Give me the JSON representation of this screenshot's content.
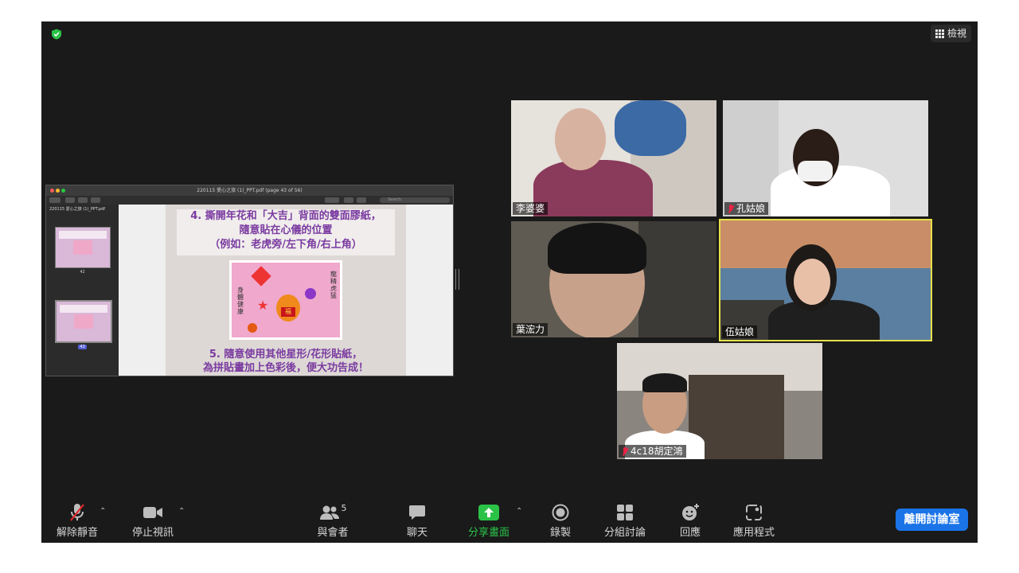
{
  "top_bar": {
    "view_label": "檢視"
  },
  "shared_screen": {
    "window_title": "220115 愛心之旅 (1)_PPT.pdf (page 43 of 56)",
    "search_placeholder": "Search",
    "sidebar_title": "220115 愛心之旅 (1)_PPT.pdf",
    "thumbnails": [
      {
        "page": "42"
      },
      {
        "page": "43"
      }
    ],
    "slide": {
      "step4_line1": "4. 撕開年花和「大吉」背面的雙面膠紙，",
      "step4_line2": "隨意貼在心儀的位置",
      "step4_line3": "（例如：老虎旁/左下角/右上角）",
      "sticker_left": "身體健康",
      "sticker_right": "龍精虎猛",
      "sticker_center": "福",
      "step5_line1": "5.  隨意使用其他星形/花形貼紙，",
      "step5_line2": "為拼貼畫加上色彩後，便大功告成！"
    }
  },
  "participants": [
    {
      "name": "李婆婆",
      "muted": false
    },
    {
      "name": "孔姑娘",
      "muted": true
    },
    {
      "name": "葉浤力",
      "muted": false
    },
    {
      "name": "伍姑娘",
      "muted": false,
      "speaking": true
    },
    {
      "name": "4c18胡定鴻",
      "muted": true
    }
  ],
  "toolbar": {
    "unmute": "解除靜音",
    "stop_video": "停止視訊",
    "participants": "與會者",
    "participants_count": "5",
    "chat": "聊天",
    "share_screen": "分享畫面",
    "record": "錄製",
    "breakout": "分組討論",
    "reactions": "回應",
    "apps": "應用程式",
    "leave": "離開討論室"
  },
  "colors": {
    "background": "#1a1a1a",
    "share_accent": "#2bc248",
    "leave_button": "#1a74e8",
    "speaker_border": "#e6e04a",
    "slide_text": "#7a3aa0"
  }
}
